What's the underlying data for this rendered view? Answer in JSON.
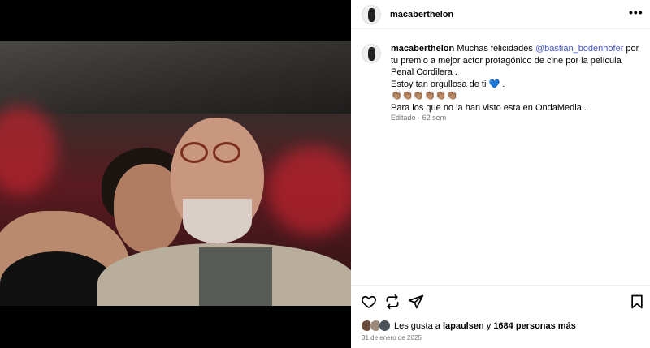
{
  "post": {
    "username": "macaberthelon",
    "more_label": "•••"
  },
  "caption": {
    "username": "macaberthelon",
    "text_1": "Muchas felicidades",
    "mention": "@bastian_bodenhofer",
    "text_2": "por tu premio a mejor actor protagónico de cine por la película Penal Cordilera .",
    "line_2": "Estoy tan orgullosa de ti",
    "line_2_emoji": "💙",
    "line_2_end": ".",
    "line_3": "👏🏽👏🏽👏🏽👏🏽👏🏽👏🏽",
    "line_4": "Para los que no la han visto esta en OndaMedia ."
  },
  "comment_meta": {
    "edited": "Editado",
    "separator": "·",
    "time": "62 sem"
  },
  "actions": {
    "like_icon": "heart-icon",
    "repost_icon": "repost-icon",
    "share_icon": "send-icon",
    "save_icon": "bookmark-icon"
  },
  "likes": {
    "prefix": "Les gusta a",
    "user": "lapaulsen",
    "connector": "y",
    "count_text": "1684 personas más"
  },
  "date": "31 de enero de 2025"
}
